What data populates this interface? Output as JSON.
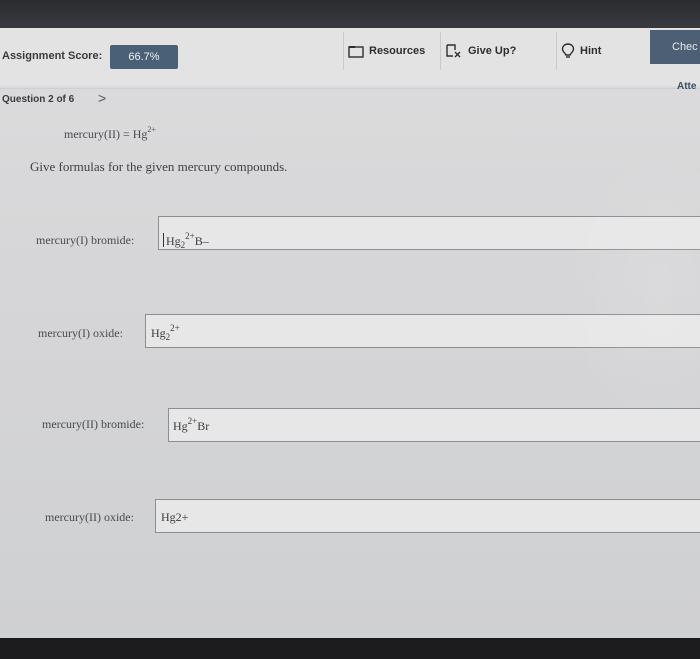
{
  "header": {
    "score_label": "Assignment Score:",
    "score_value": "66.7%",
    "resources_label": "Resources",
    "giveup_label": "Give Up?",
    "hint_label": "Hint",
    "check_label": "Chec"
  },
  "question_nav": {
    "label": "Question 2 of 6",
    "next_arrow": ">",
    "attempt_label": "Atte"
  },
  "given": {
    "name": "mercury(II) = Hg",
    "charge": "2+"
  },
  "instruction": "Give formulas for the given mercury compounds.",
  "rows": [
    {
      "label": "mercury(I) bromide:",
      "base": "Hg",
      "sub": "2",
      "sup": "2+",
      "tail": " B–"
    },
    {
      "label": "mercury(I) oxide:",
      "base": "Hg",
      "sub": "2",
      "sup": "2+",
      "tail": ""
    },
    {
      "label": "mercury(II) bromide:",
      "base": "Hg",
      "sub": "",
      "sup": "2+",
      "tail": " Br"
    },
    {
      "label": "mercury(II) oxide:",
      "base": "Hg2+",
      "sub": "",
      "sup": "",
      "tail": ""
    }
  ],
  "icons": {
    "resources": "folder-icon",
    "giveup": "flag-x-icon",
    "hint": "lightbulb-icon"
  },
  "colors": {
    "score_badge": "#4a6076",
    "check_button": "#4c5f74"
  }
}
